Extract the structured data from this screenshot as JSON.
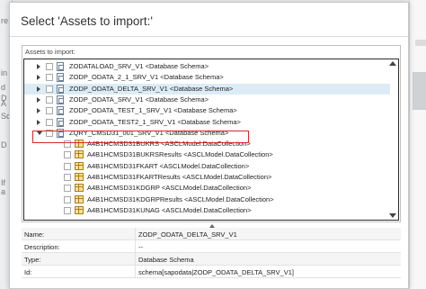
{
  "dialog": {
    "title": "Select 'Assets to import:'",
    "panel_label": "Assets to import:"
  },
  "tree_rows": [
    {
      "label": "ZODATALOAD_SRV_V1 <Database Schema>",
      "type": "schema",
      "expand": "right",
      "selected": false
    },
    {
      "label": "ZODP_ODATA_2_1_SRV_V1 <Database Schema>",
      "type": "schema",
      "expand": "right",
      "selected": false
    },
    {
      "label": "ZODP_ODATA_DELTA_SRV_V1 <Database Schema>",
      "type": "schema",
      "expand": "right",
      "selected": true
    },
    {
      "label": "ZODP_ODATA_SRV_V1 <Database Schema>",
      "type": "schema",
      "expand": "right",
      "selected": false
    },
    {
      "label": "ZODP_ODATA_TEST_1_SRV_V1 <Database Schema>",
      "type": "schema",
      "expand": "right",
      "selected": false
    },
    {
      "label": "ZODP_ODATA_TEST2_1_SRV_V1 <Database Schema>",
      "type": "schema",
      "expand": "right",
      "selected": false
    },
    {
      "label": "ZQRY_CMSD31_001_SRV_V1 <Database Schema>",
      "type": "schema",
      "expand": "down",
      "selected": false
    },
    {
      "label": "A4B1HCMSD31BUKRS <ASCLModel.DataCollection>",
      "type": "collection",
      "expand": "none",
      "selected": false
    },
    {
      "label": "A4B1HCMSD31BUKRSResults <ASCLModel.DataCollection>",
      "type": "collection",
      "expand": "none",
      "selected": false
    },
    {
      "label": "A4B1HCMSD31FKART <ASCLModel.DataCollection>",
      "type": "collection",
      "expand": "none",
      "selected": false
    },
    {
      "label": "A4B1HCMSD31FKARTResults <ASCLModel.DataCollection>",
      "type": "collection",
      "expand": "none",
      "selected": false
    },
    {
      "label": "A4B1HCMSD31KDGRP <ASCLModel.DataCollection>",
      "type": "collection",
      "expand": "none",
      "selected": false
    },
    {
      "label": "A4B1HCMSD31KDGRPResults <ASCLModel.DataCollection>",
      "type": "collection",
      "expand": "none",
      "selected": false
    },
    {
      "label": "A4B1HCMSD31KUNAG <ASCLModel.DataCollection>",
      "type": "collection",
      "expand": "none",
      "selected": false
    }
  ],
  "properties": [
    {
      "key": "Name:",
      "value": "ZODP_ODATA_DELTA_SRV_V1"
    },
    {
      "key": "Description:",
      "value": "--"
    },
    {
      "key": "Type:",
      "value": "Database Schema"
    },
    {
      "key": "Id:",
      "value": "schema[sapodata|ZODP_ODATA_DELTA_SRV_V1]"
    }
  ],
  "background_fragments": {
    "left": [
      "re",
      "d",
      "in",
      "D",
      "D",
      "A",
      "Sc",
      "If",
      "a"
    ]
  },
  "colors": {
    "selected_row": "#dcecf6",
    "highlight_border": "#d42a2a"
  }
}
